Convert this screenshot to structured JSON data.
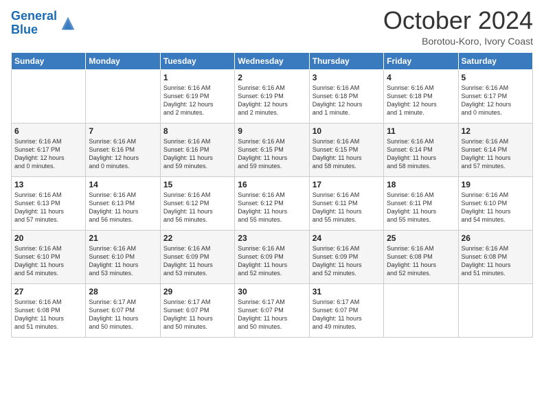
{
  "header": {
    "logo_line1": "General",
    "logo_line2": "Blue",
    "month": "October 2024",
    "location": "Borotou-Koro, Ivory Coast"
  },
  "columns": [
    "Sunday",
    "Monday",
    "Tuesday",
    "Wednesday",
    "Thursday",
    "Friday",
    "Saturday"
  ],
  "weeks": [
    [
      {
        "day": "",
        "info": ""
      },
      {
        "day": "",
        "info": ""
      },
      {
        "day": "1",
        "info": "Sunrise: 6:16 AM\nSunset: 6:19 PM\nDaylight: 12 hours\nand 2 minutes."
      },
      {
        "day": "2",
        "info": "Sunrise: 6:16 AM\nSunset: 6:19 PM\nDaylight: 12 hours\nand 2 minutes."
      },
      {
        "day": "3",
        "info": "Sunrise: 6:16 AM\nSunset: 6:18 PM\nDaylight: 12 hours\nand 1 minute."
      },
      {
        "day": "4",
        "info": "Sunrise: 6:16 AM\nSunset: 6:18 PM\nDaylight: 12 hours\nand 1 minute."
      },
      {
        "day": "5",
        "info": "Sunrise: 6:16 AM\nSunset: 6:17 PM\nDaylight: 12 hours\nand 0 minutes."
      }
    ],
    [
      {
        "day": "6",
        "info": "Sunrise: 6:16 AM\nSunset: 6:17 PM\nDaylight: 12 hours\nand 0 minutes."
      },
      {
        "day": "7",
        "info": "Sunrise: 6:16 AM\nSunset: 6:16 PM\nDaylight: 12 hours\nand 0 minutes."
      },
      {
        "day": "8",
        "info": "Sunrise: 6:16 AM\nSunset: 6:16 PM\nDaylight: 11 hours\nand 59 minutes."
      },
      {
        "day": "9",
        "info": "Sunrise: 6:16 AM\nSunset: 6:15 PM\nDaylight: 11 hours\nand 59 minutes."
      },
      {
        "day": "10",
        "info": "Sunrise: 6:16 AM\nSunset: 6:15 PM\nDaylight: 11 hours\nand 58 minutes."
      },
      {
        "day": "11",
        "info": "Sunrise: 6:16 AM\nSunset: 6:14 PM\nDaylight: 11 hours\nand 58 minutes."
      },
      {
        "day": "12",
        "info": "Sunrise: 6:16 AM\nSunset: 6:14 PM\nDaylight: 11 hours\nand 57 minutes."
      }
    ],
    [
      {
        "day": "13",
        "info": "Sunrise: 6:16 AM\nSunset: 6:13 PM\nDaylight: 11 hours\nand 57 minutes."
      },
      {
        "day": "14",
        "info": "Sunrise: 6:16 AM\nSunset: 6:13 PM\nDaylight: 11 hours\nand 56 minutes."
      },
      {
        "day": "15",
        "info": "Sunrise: 6:16 AM\nSunset: 6:12 PM\nDaylight: 11 hours\nand 56 minutes."
      },
      {
        "day": "16",
        "info": "Sunrise: 6:16 AM\nSunset: 6:12 PM\nDaylight: 11 hours\nand 55 minutes."
      },
      {
        "day": "17",
        "info": "Sunrise: 6:16 AM\nSunset: 6:11 PM\nDaylight: 11 hours\nand 55 minutes."
      },
      {
        "day": "18",
        "info": "Sunrise: 6:16 AM\nSunset: 6:11 PM\nDaylight: 11 hours\nand 55 minutes."
      },
      {
        "day": "19",
        "info": "Sunrise: 6:16 AM\nSunset: 6:10 PM\nDaylight: 11 hours\nand 54 minutes."
      }
    ],
    [
      {
        "day": "20",
        "info": "Sunrise: 6:16 AM\nSunset: 6:10 PM\nDaylight: 11 hours\nand 54 minutes."
      },
      {
        "day": "21",
        "info": "Sunrise: 6:16 AM\nSunset: 6:10 PM\nDaylight: 11 hours\nand 53 minutes."
      },
      {
        "day": "22",
        "info": "Sunrise: 6:16 AM\nSunset: 6:09 PM\nDaylight: 11 hours\nand 53 minutes."
      },
      {
        "day": "23",
        "info": "Sunrise: 6:16 AM\nSunset: 6:09 PM\nDaylight: 11 hours\nand 52 minutes."
      },
      {
        "day": "24",
        "info": "Sunrise: 6:16 AM\nSunset: 6:09 PM\nDaylight: 11 hours\nand 52 minutes."
      },
      {
        "day": "25",
        "info": "Sunrise: 6:16 AM\nSunset: 6:08 PM\nDaylight: 11 hours\nand 52 minutes."
      },
      {
        "day": "26",
        "info": "Sunrise: 6:16 AM\nSunset: 6:08 PM\nDaylight: 11 hours\nand 51 minutes."
      }
    ],
    [
      {
        "day": "27",
        "info": "Sunrise: 6:16 AM\nSunset: 6:08 PM\nDaylight: 11 hours\nand 51 minutes."
      },
      {
        "day": "28",
        "info": "Sunrise: 6:17 AM\nSunset: 6:07 PM\nDaylight: 11 hours\nand 50 minutes."
      },
      {
        "day": "29",
        "info": "Sunrise: 6:17 AM\nSunset: 6:07 PM\nDaylight: 11 hours\nand 50 minutes."
      },
      {
        "day": "30",
        "info": "Sunrise: 6:17 AM\nSunset: 6:07 PM\nDaylight: 11 hours\nand 50 minutes."
      },
      {
        "day": "31",
        "info": "Sunrise: 6:17 AM\nSunset: 6:07 PM\nDaylight: 11 hours\nand 49 minutes."
      },
      {
        "day": "",
        "info": ""
      },
      {
        "day": "",
        "info": ""
      }
    ]
  ]
}
